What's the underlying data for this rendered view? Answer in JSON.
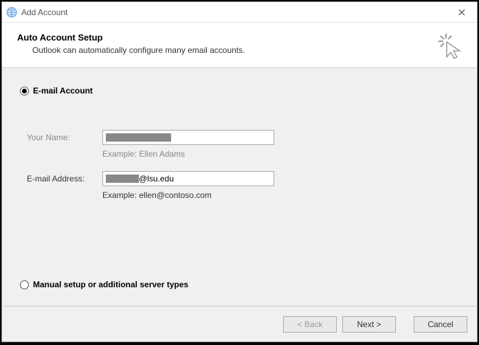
{
  "window": {
    "title": "Add Account"
  },
  "header": {
    "title": "Auto Account Setup",
    "subtitle": "Outlook can automatically configure many email accounts."
  },
  "options": {
    "email_account_label": "E-mail Account",
    "manual_setup_label": "Manual setup or additional server types",
    "selected": "email_account"
  },
  "form": {
    "name_label": "Your Name:",
    "name_value": "",
    "name_example": "Example: Ellen Adams",
    "email_label": "E-mail Address:",
    "email_value_suffix": "@lsu.edu",
    "email_example": "Example: ellen@contoso.com"
  },
  "buttons": {
    "back": "< Back",
    "next": "Next >",
    "cancel": "Cancel"
  }
}
